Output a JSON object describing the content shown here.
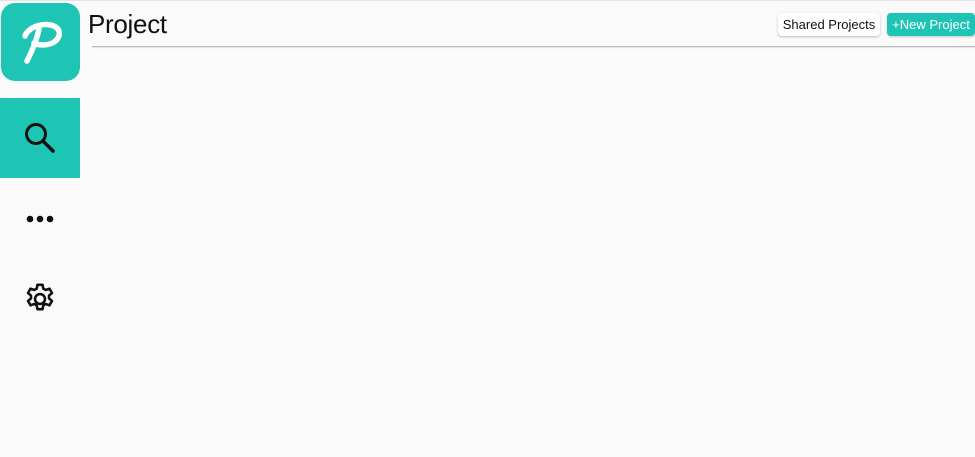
{
  "app": {
    "logo_letter": "P",
    "accent_color": "#1ec4b4"
  },
  "sidebar": {
    "items": [
      {
        "name": "search",
        "icon": "search-icon",
        "active": true
      },
      {
        "name": "more",
        "icon": "more-horizontal-icon",
        "active": false
      },
      {
        "name": "settings",
        "icon": "gear-icon",
        "active": false
      }
    ]
  },
  "header": {
    "title": "Project",
    "shared_projects_label": "Shared Projects",
    "new_project_label": "+New Project"
  }
}
